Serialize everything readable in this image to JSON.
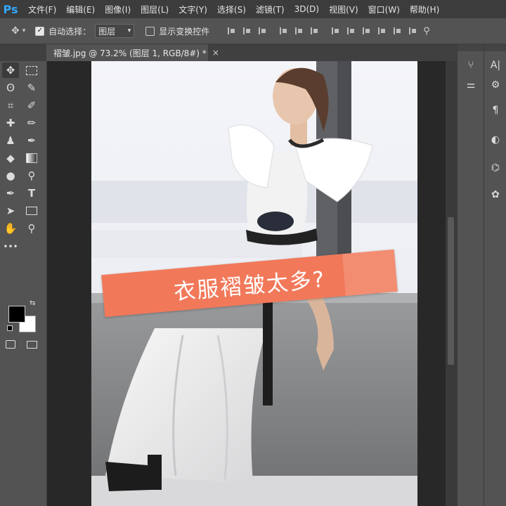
{
  "app": {
    "logo": "Ps"
  },
  "menu": [
    "文件(F)",
    "编辑(E)",
    "图像(I)",
    "图层(L)",
    "文字(Y)",
    "选择(S)",
    "滤镜(T)",
    "3D(D)",
    "视图(V)",
    "窗口(W)",
    "帮助(H)"
  ],
  "options": {
    "auto_select_label": "自动选择：",
    "auto_select_target": "图层",
    "show_transform_label": "显示变换控件"
  },
  "document_tab": {
    "title": "褶皱.jpg @ 73.2% (图层 1, RGB/8#) *",
    "close": "×"
  },
  "image": {
    "banner_text": "衣服褶皱太多?",
    "banner_color": "#f1795a"
  },
  "colors": {
    "foreground": "#000000",
    "background": "#ffffff"
  }
}
